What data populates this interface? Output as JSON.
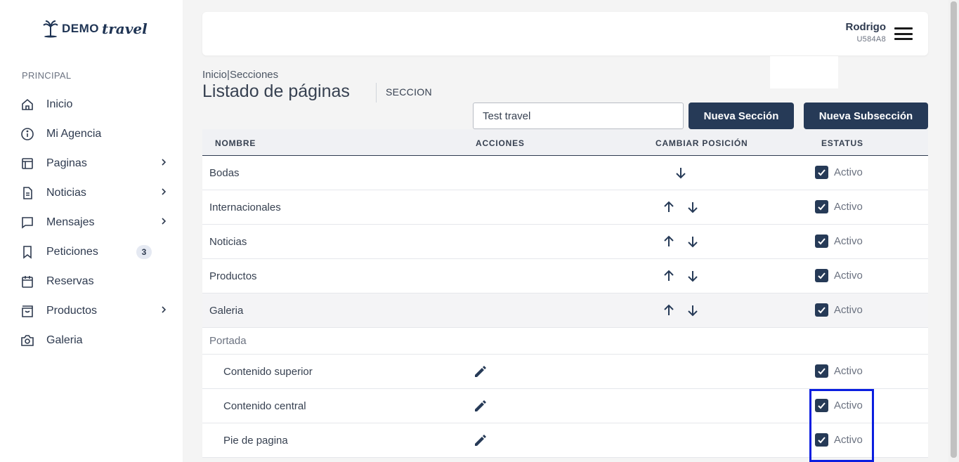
{
  "brand": {
    "demo": "DEMO",
    "travel": "travel"
  },
  "sidebar": {
    "section_label": "PRINCIPAL",
    "items": [
      {
        "label": "Inicio",
        "icon": "home-icon"
      },
      {
        "label": "Mi Agencia",
        "icon": "info-icon"
      },
      {
        "label": "Paginas",
        "icon": "layout-icon",
        "has_submenu": true
      },
      {
        "label": "Noticias",
        "icon": "document-icon",
        "has_submenu": true
      },
      {
        "label": "Mensajes",
        "icon": "message-icon",
        "has_submenu": true
      },
      {
        "label": "Peticiones",
        "icon": "bookmark-icon",
        "badge": "3"
      },
      {
        "label": "Reservas",
        "icon": "calendar-icon"
      },
      {
        "label": "Productos",
        "icon": "bag-icon",
        "has_submenu": true
      },
      {
        "label": "Galeria",
        "icon": "camera-icon"
      }
    ]
  },
  "header": {
    "user_name": "Rodrigo",
    "user_code": "U584A8"
  },
  "breadcrumb": {
    "home": "Inicio",
    "separator": "|",
    "current": "Secciones"
  },
  "page": {
    "title": "Listado de páginas",
    "subtitle": "SECCION"
  },
  "toolbar": {
    "search_value": "Test travel",
    "new_section_label": "Nueva Sección",
    "new_subsection_label": "Nueva Subsección"
  },
  "table": {
    "headers": {
      "name": "NOMBRE",
      "actions": "ACCIONES",
      "position": "CAMBIAR POSICIÓN",
      "status": "ESTATUS"
    },
    "rows": [
      {
        "name": "Bodas",
        "up": false,
        "down": true,
        "status": "Activo",
        "checked": true
      },
      {
        "name": "Internacionales",
        "up": true,
        "down": true,
        "status": "Activo",
        "checked": true
      },
      {
        "name": "Noticias",
        "up": true,
        "down": true,
        "status": "Activo",
        "checked": true
      },
      {
        "name": "Productos",
        "up": true,
        "down": true,
        "status": "Activo",
        "checked": true
      },
      {
        "name": "Galeria",
        "up": true,
        "down": true,
        "status": "Activo",
        "checked": true
      }
    ],
    "group": {
      "name": "Portada"
    },
    "subrows": [
      {
        "name": "Contenido superior",
        "status": "Activo",
        "checked": true
      },
      {
        "name": "Contenido central",
        "status": "Activo",
        "checked": true
      },
      {
        "name": "Pie de pagina",
        "status": "Activo",
        "checked": true
      }
    ]
  },
  "colors": {
    "primary": "#263a57",
    "highlight_border": "#0a1ee0"
  }
}
